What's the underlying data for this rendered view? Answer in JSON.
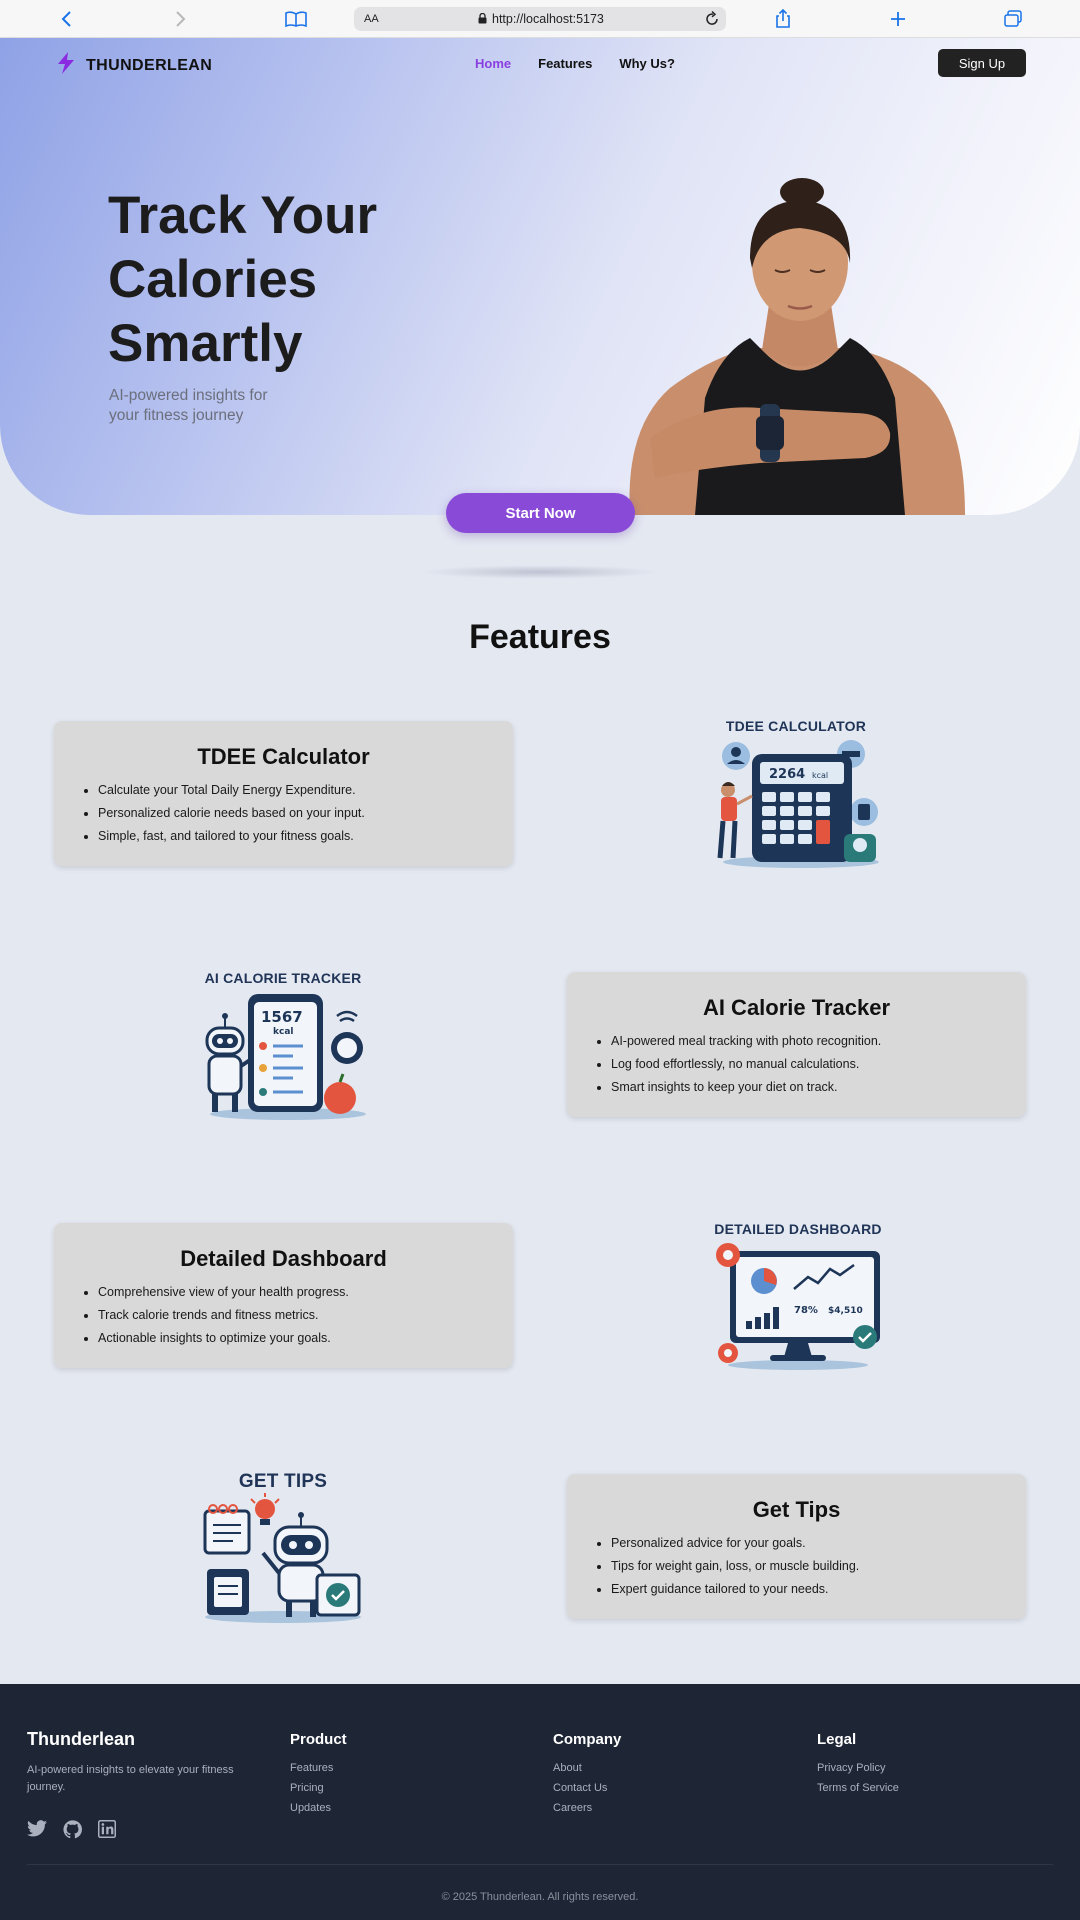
{
  "browser": {
    "text_size_label": "AA",
    "url": "http://localhost:5173"
  },
  "nav": {
    "brand": "THUNDERLEAN",
    "links": [
      "Home",
      "Features",
      "Why Us?"
    ],
    "active_link": "Home",
    "signup_label": "Sign Up"
  },
  "hero": {
    "title_lines": [
      "Track Your",
      "Calories",
      "Smartly"
    ],
    "subtitle_lines": [
      "AI-powered insights for",
      "your fitness journey"
    ],
    "cta_label": "Start Now"
  },
  "features": {
    "title": "Features",
    "cards": [
      {
        "title": "TDEE Calculator",
        "bullets": [
          "Calculate your Total Daily Energy Expenditure.",
          "Personalized calorie needs based on your input.",
          "Simple, fast, and tailored to your fitness goals."
        ],
        "illustration_title": "TDEE CALCULATOR",
        "illustration_value": "2264",
        "illustration_unit": "kcal"
      },
      {
        "title": "AI Calorie Tracker",
        "bullets": [
          "AI-powered meal tracking with photo recognition.",
          "Log food effortlessly, no manual calculations.",
          "Smart insights to keep your diet on track."
        ],
        "illustration_title": "AI CALORIE TRACKER",
        "illustration_value": "1567",
        "illustration_unit": "kcal"
      },
      {
        "title": "Detailed Dashboard",
        "bullets": [
          "Comprehensive view of your health progress.",
          "Track calorie trends and fitness metrics.",
          "Actionable insights to optimize your goals."
        ],
        "illustration_title": "DETAILED DASHBOARD",
        "illustration_value": "78%",
        "illustration_unit": "$4,510"
      },
      {
        "title": "Get Tips",
        "bullets": [
          "Personalized advice for your goals.",
          "Tips for weight gain, loss, or muscle building.",
          "Expert guidance tailored to your needs."
        ],
        "illustration_title": "GET TIPS"
      }
    ]
  },
  "footer": {
    "brand": "Thunderlean",
    "tagline": "AI-powered insights to elevate your fitness journey.",
    "columns": [
      {
        "title": "Product",
        "links": [
          "Features",
          "Pricing",
          "Updates"
        ]
      },
      {
        "title": "Company",
        "links": [
          "About",
          "Contact Us",
          "Careers"
        ]
      },
      {
        "title": "Legal",
        "links": [
          "Privacy Policy",
          "Terms of Service"
        ]
      }
    ],
    "social_icons": [
      "twitter-icon",
      "github-icon",
      "linkedin-icon"
    ],
    "copyright": "© 2025 Thunderlean. All rights reserved."
  },
  "colors": {
    "accent": "#8a4ad8",
    "active_nav": "#8a3fe0",
    "footer_bg": "#1e2535",
    "card_bg": "#d9d9d9",
    "page_bg": "#e4e8f1"
  }
}
